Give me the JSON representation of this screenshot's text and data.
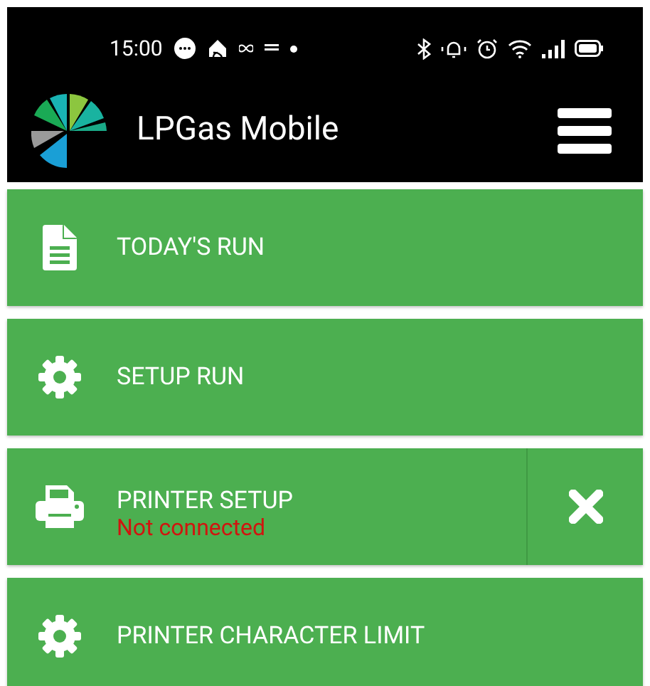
{
  "status_bar": {
    "time": "15:00"
  },
  "app_bar": {
    "title": "LPGas Mobile"
  },
  "menu": [
    {
      "kind": "document",
      "label": "TODAY'S RUN",
      "clear_button": false
    },
    {
      "kind": "gear",
      "label": "SETUP RUN",
      "clear_button": false
    },
    {
      "kind": "printer",
      "label": "PRINTER SETUP",
      "status": "Not connected",
      "clear_button": true
    },
    {
      "kind": "gear",
      "label": "PRINTER CHARACTER LIMIT",
      "clear_button": false
    }
  ]
}
